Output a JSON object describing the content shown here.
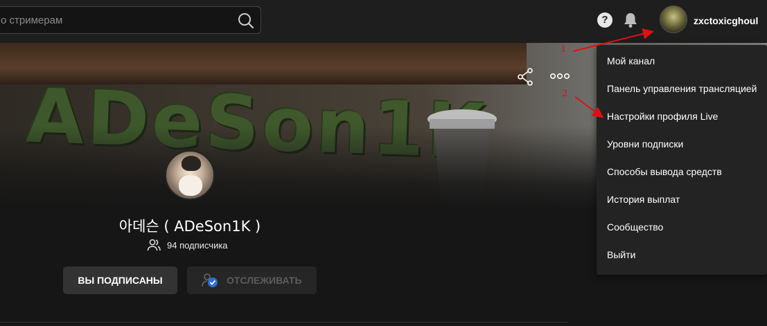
{
  "header": {
    "search_placeholder": "о стримерам",
    "help_symbol": "?",
    "username": "zxctoxicghoul"
  },
  "banner": {
    "title_art": "ADeSon1K"
  },
  "channel": {
    "name": "아데슨 ( ADeSon1K )",
    "subscribers": "94 подписчика"
  },
  "buttons": {
    "subscribed": "ВЫ ПОДПИСАНЫ",
    "follow": "ОТСЛЕЖИВАТЬ"
  },
  "menu": {
    "items": [
      "Мой канал",
      "Панель управления трансляцией",
      "Настройки профиля Live",
      "Уровни подписки",
      "Способы вывода средств",
      "История выплат",
      "Сообщество",
      "Выйти"
    ]
  },
  "annotations": {
    "marker_1": "1",
    "marker_2": "2",
    "color": "#e01010"
  },
  "colors": {
    "background": "#161616",
    "menu_background": "#232323",
    "button_subscribed": "#333333",
    "follow_check": "#2f6fd0"
  }
}
